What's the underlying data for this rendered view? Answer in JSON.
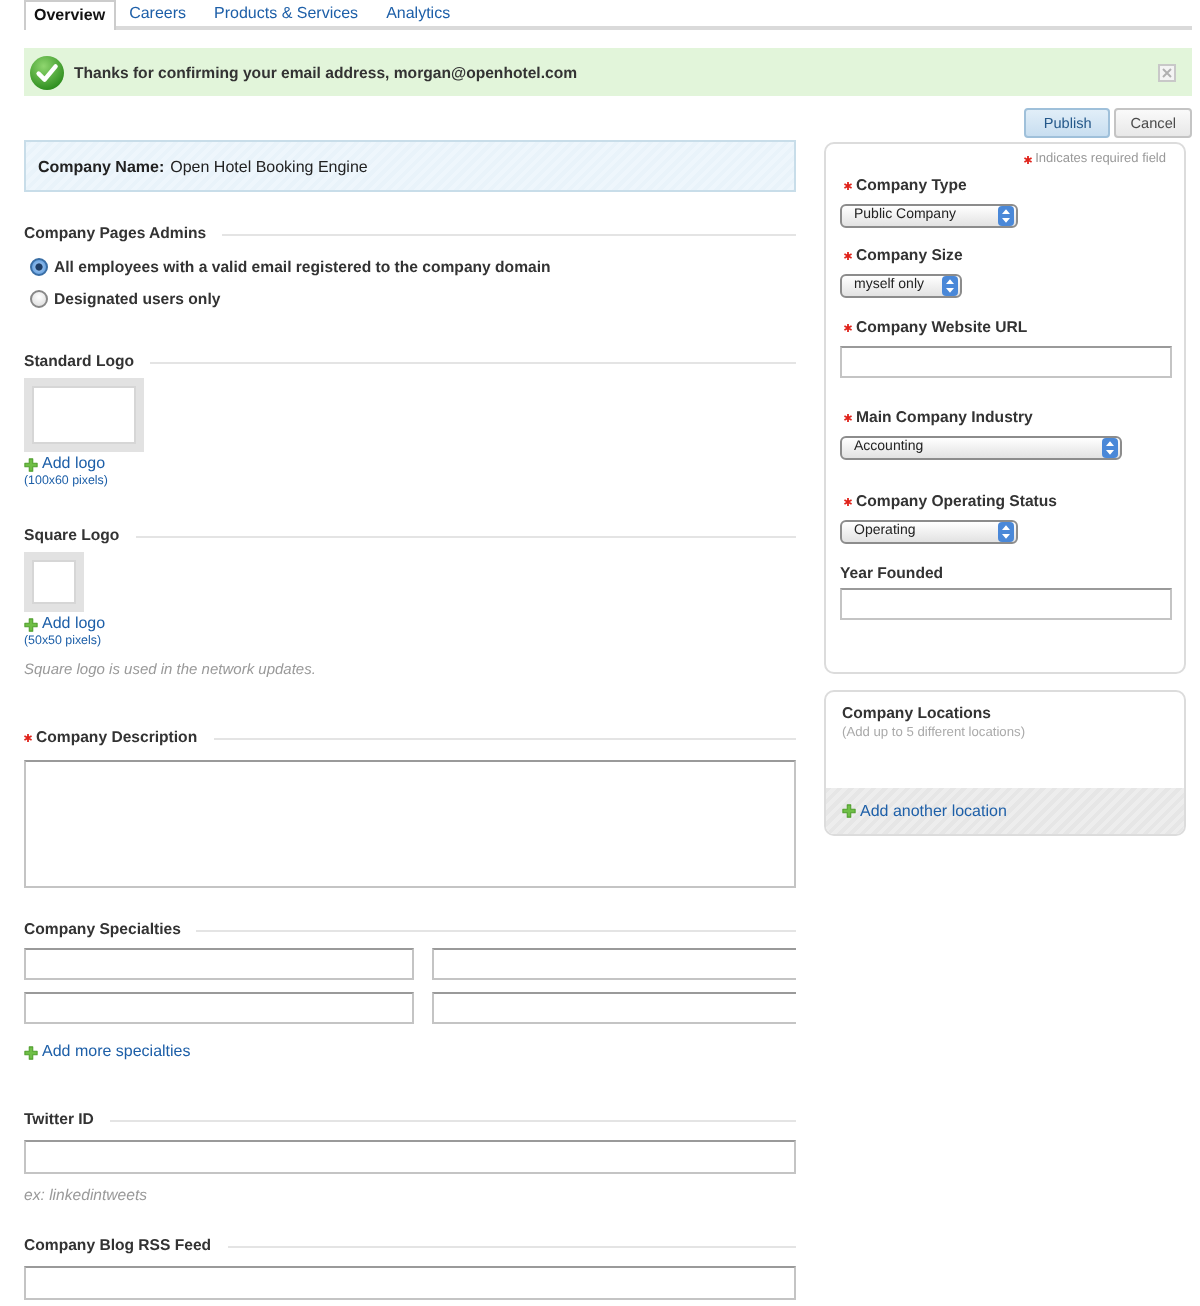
{
  "tabs": [
    {
      "label": "Overview",
      "selected": true
    },
    {
      "label": "Careers",
      "selected": false
    },
    {
      "label": "Products & Services",
      "selected": false
    },
    {
      "label": "Analytics",
      "selected": false
    }
  ],
  "notice": {
    "text": "Thanks for confirming your email address, morgan@openhotel.com"
  },
  "actions": [
    {
      "label": "Publish",
      "kind": "primary"
    },
    {
      "label": "Cancel",
      "kind": "secondary"
    }
  ],
  "company_name": {
    "label": "Company Name:",
    "value": "Open Hotel Booking Engine"
  },
  "sections": [
    {
      "kind": "radios",
      "title": "Company Pages Admins",
      "required": false,
      "options": [
        {
          "label": "All employees with a valid email registered to the company domain",
          "selected": true
        },
        {
          "label": "Designated users only",
          "selected": false
        }
      ]
    },
    {
      "kind": "logo",
      "title": "Standard Logo",
      "required": false,
      "link": "Add logo",
      "hint": "(100x60 pixels)"
    },
    {
      "kind": "squarelogo",
      "title": "Square Logo",
      "required": false,
      "link": "Add logo",
      "hint": "(50x50 pixels)",
      "note": "Square logo is used in the network updates."
    },
    {
      "kind": "textarea",
      "title": "Company Description",
      "required": true
    },
    {
      "kind": "grid",
      "title": "Company Specialties",
      "required": false,
      "link": "Add more specialties"
    },
    {
      "kind": "text",
      "title": "Twitter ID",
      "required": false,
      "hint": "ex: linkedintweets"
    },
    {
      "kind": "text",
      "title": "Company Blog RSS Feed",
      "required": false
    }
  ],
  "details": {
    "legend": "Indicates required field",
    "fields": [
      {
        "kind": "select",
        "label": "Company Type",
        "required": true,
        "value": "Public Company"
      },
      {
        "kind": "select",
        "label": "Company Size",
        "required": true,
        "value": "myself only"
      },
      {
        "kind": "text",
        "label": "Company Website URL",
        "required": true
      },
      {
        "kind": "select",
        "label": "Main Company Industry",
        "required": true,
        "value": "Accounting"
      },
      {
        "kind": "select",
        "label": "Company Operating Status",
        "required": true,
        "value": "Operating"
      },
      {
        "kind": "text",
        "label": "Year Founded",
        "required": false
      }
    ]
  },
  "locations": {
    "title": "Company Locations",
    "subtitle": "(Add up to 5 different locations)",
    "link": "Add another location"
  }
}
